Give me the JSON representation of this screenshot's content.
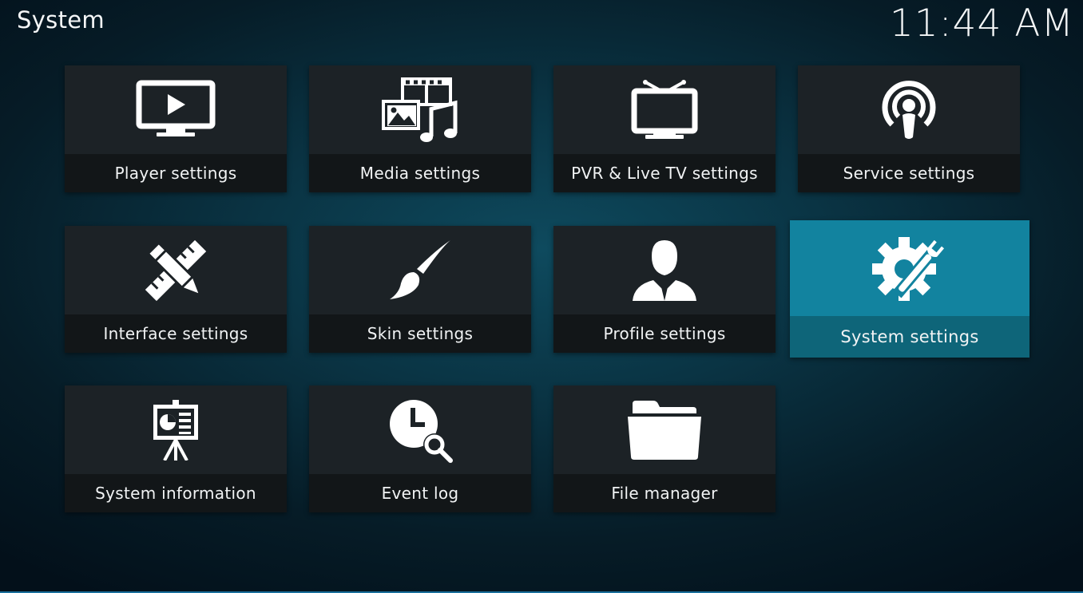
{
  "header": {
    "title": "System",
    "clock": "11:44 AM"
  },
  "tiles": [
    {
      "label": "Player settings",
      "icon": "tv-play-icon"
    },
    {
      "label": "Media settings",
      "icon": "media-icon"
    },
    {
      "label": "PVR & Live TV settings",
      "icon": "antenna-tv-icon"
    },
    {
      "label": "Service settings",
      "icon": "broadcast-icon"
    },
    {
      "label": "Interface settings",
      "icon": "pencil-ruler-icon"
    },
    {
      "label": "Skin settings",
      "icon": "paintbrush-icon"
    },
    {
      "label": "Profile settings",
      "icon": "user-icon"
    },
    {
      "label": "System settings",
      "icon": "gear-tools-icon",
      "focused": true
    },
    {
      "label": "System information",
      "icon": "presentation-icon"
    },
    {
      "label": "Event log",
      "icon": "clock-search-icon"
    },
    {
      "label": "File manager",
      "icon": "folder-icon"
    }
  ],
  "colors": {
    "accent": "#12839f",
    "tile": "#1c2226",
    "tile_label": "#121618"
  }
}
